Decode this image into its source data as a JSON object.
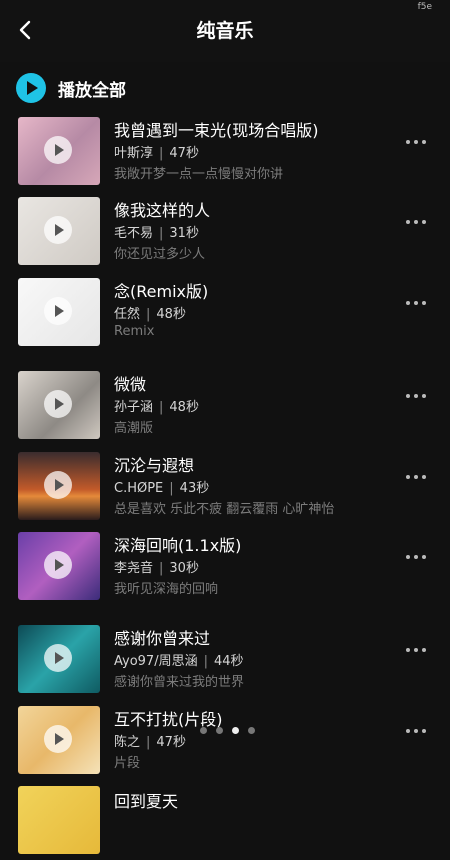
{
  "status_corner": "f5e",
  "header": {
    "title": "纯音乐"
  },
  "play_all": {
    "label": "播放全部"
  },
  "tracks": [
    {
      "title": "我曾遇到一束光(现场合唱版)",
      "artist": "叶斯淳",
      "duration": "47秒",
      "desc": "我敞开梦一点一点慢慢对你讲"
    },
    {
      "title": "像我这样的人",
      "artist": "毛不易",
      "duration": "31秒",
      "desc": "你还见过多少人"
    },
    {
      "title": "念(Remix版)",
      "artist": "任然",
      "duration": "48秒",
      "desc": "Remix"
    },
    {
      "title": "微微",
      "artist": "孙子涵",
      "duration": "48秒",
      "desc": "高潮版"
    },
    {
      "title": "沉沦与遐想",
      "artist": "C.HØPE",
      "duration": "43秒",
      "desc": "总是喜欢 乐此不疲 翻云覆雨 心旷神怡"
    },
    {
      "title": "深海回响(1.1x版)",
      "artist": "李尧音",
      "duration": "30秒",
      "desc": "我听见深海的回响"
    },
    {
      "title": "感谢你曾来过",
      "artist": "Ayo97/周思涵",
      "duration": "44秒",
      "desc": "感谢你曾来过我的世界"
    },
    {
      "title": "互不打扰(片段)",
      "artist": "陈之",
      "duration": "47秒",
      "desc": "片段"
    },
    {
      "title": "回到夏天",
      "artist": "",
      "duration": "",
      "desc": ""
    }
  ],
  "pager": {
    "count": 4,
    "active": 2
  }
}
